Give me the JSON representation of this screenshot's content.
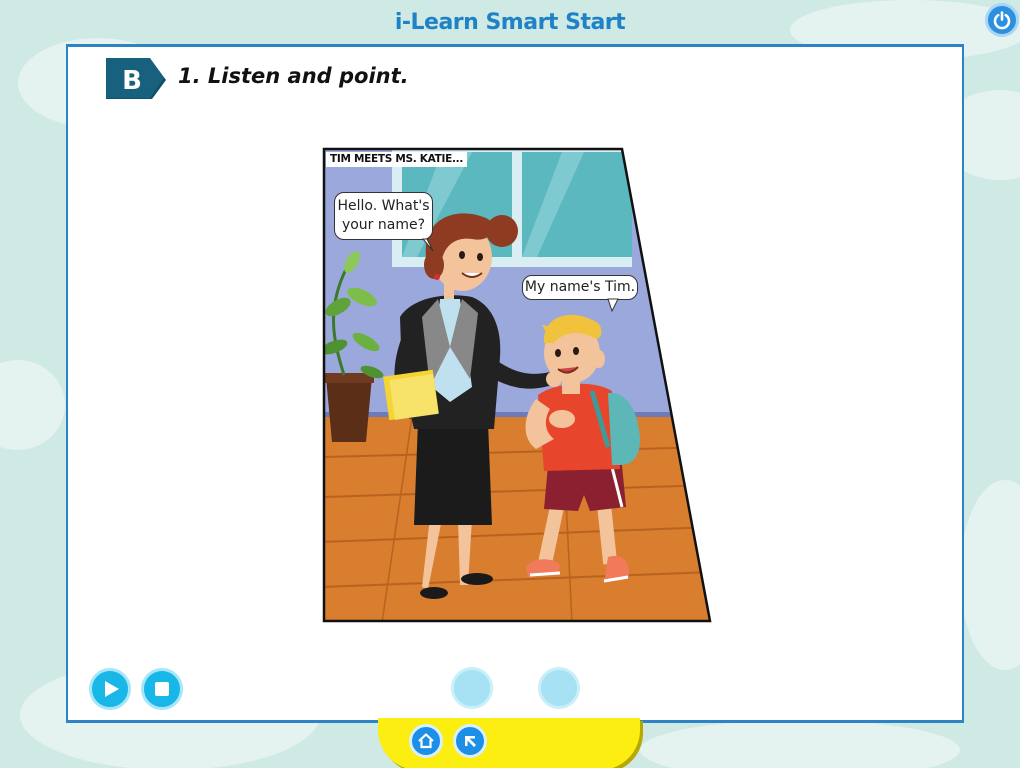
{
  "app": {
    "title": "i-Learn Smart Start"
  },
  "lesson": {
    "section_letter": "B",
    "instruction": "1. Listen and point."
  },
  "comic": {
    "caption": "TIM MEETS MS. KATIE...",
    "teacher_line_1": "Hello. What's",
    "teacher_line_2": "your name?",
    "tim_line": "My name's Tim."
  },
  "controls": {
    "play_icon": "play-icon",
    "stop_icon": "stop-icon",
    "home_icon": "home-icon",
    "back_icon": "back-arrow-icon",
    "power_icon": "power-icon"
  },
  "colors": {
    "accent": "#1f82c6",
    "tray": "#fcee10",
    "button": "#18b7e8",
    "badge": "#17617f"
  }
}
